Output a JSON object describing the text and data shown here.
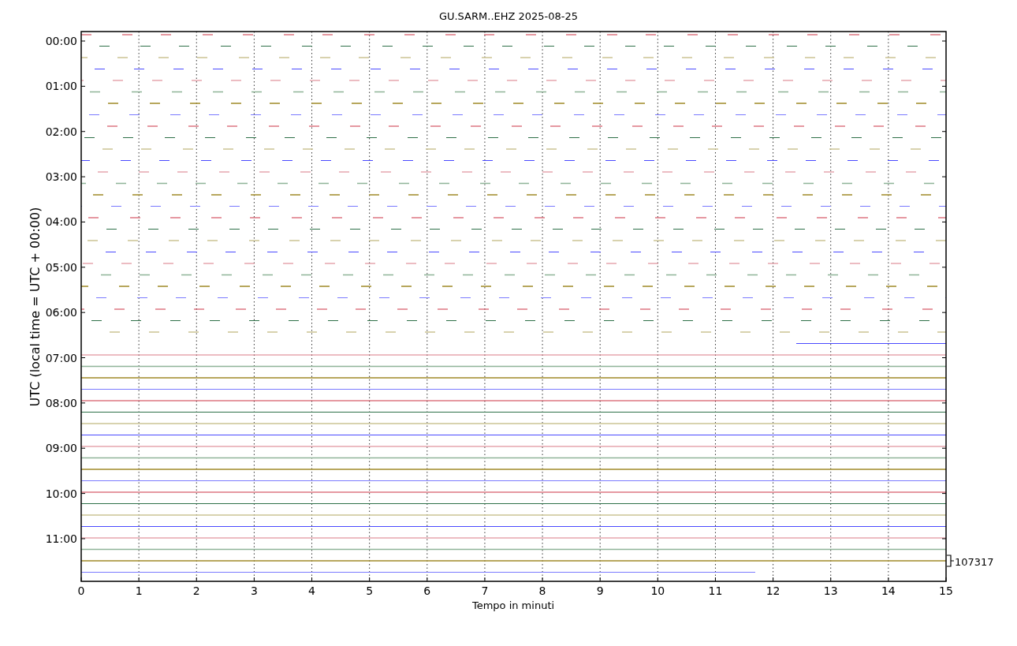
{
  "title": "GU.SARM..EHZ 2025-08-25",
  "ylabel": "UTC (local time = UTC + 00:00)",
  "xlabel": "Tempo in minuti",
  "yticks": [
    "00:00",
    "01:00",
    "02:00",
    "03:00",
    "04:00",
    "05:00",
    "06:00",
    "07:00",
    "08:00",
    "09:00",
    "10:00",
    "11:00"
  ],
  "xticks": [
    "0",
    "1",
    "2",
    "3",
    "4",
    "5",
    "6",
    "7",
    "8",
    "9",
    "10",
    "11",
    "12",
    "13",
    "14",
    "15"
  ],
  "scale_label": "107317"
}
